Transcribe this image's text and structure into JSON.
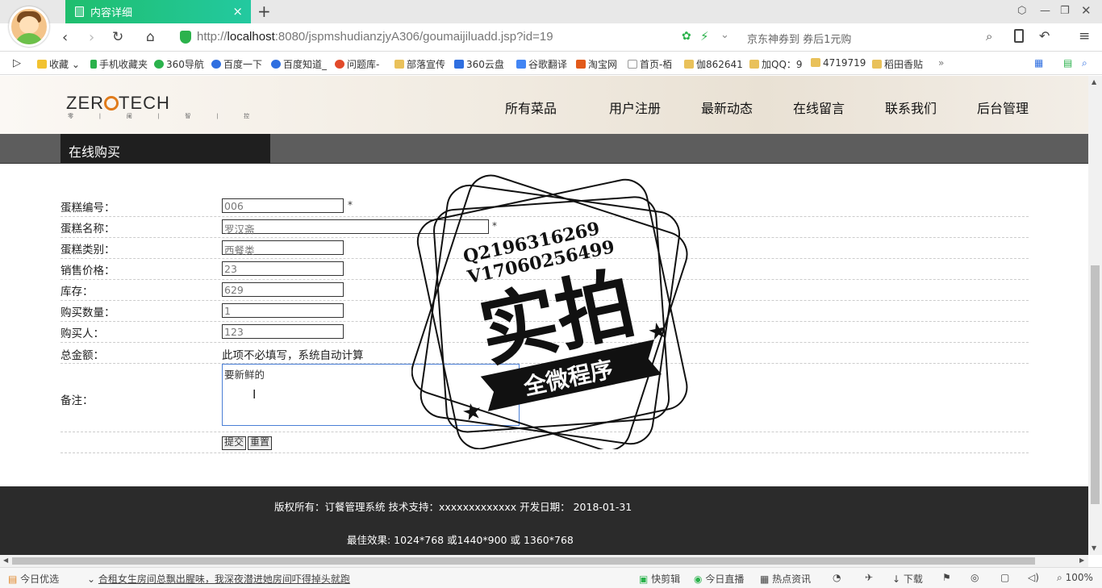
{
  "browser": {
    "tab_title": "内容详细",
    "url_prefix": "http://",
    "url_host": "localhost",
    "url_rest": ":8080/jspmshudianzjyA306/goumaijiluadd.jsp?id=19",
    "search_hint": "京东神券到 券后1元购",
    "bookmarks": [
      "收藏",
      "手机收藏夹",
      "360导航",
      "百度一下",
      "百度知道_",
      "问题库-",
      "部落宣传",
      "360云盘",
      "谷歌翻译",
      "淘宝网",
      "首页-栢",
      "伽862641",
      "加QQ：9",
      "4719719",
      "稻田香贴"
    ]
  },
  "site": {
    "logo": "ZER  TECH",
    "logo_sub": "零 | 阑 | 智 | 控",
    "nav": [
      "所有菜品",
      "用户注册",
      "最新动态",
      "在线留言",
      "联系我们",
      "后台管理"
    ],
    "section_title": "在线购买"
  },
  "form": {
    "fields": [
      {
        "label": "蛋糕编号：",
        "value": "006",
        "required": "*"
      },
      {
        "label": "蛋糕名称：",
        "value": "罗汉斋",
        "required": "*"
      },
      {
        "label": "蛋糕类别：",
        "value": "西餐类"
      },
      {
        "label": "销售价格：",
        "value": "23"
      },
      {
        "label": "库存：",
        "value": "629"
      },
      {
        "label": "购买数量：",
        "value": "1"
      },
      {
        "label": "购买人：",
        "value": "123"
      }
    ],
    "total_label": "总金额：",
    "total_hint": "此项不必填写，系统自动计算",
    "note_label": "备注：",
    "note_value": "要新鲜的",
    "submit": "提交",
    "reset": "重置"
  },
  "stamp": {
    "line1": "Q2196316269",
    "line2": "V17060256499",
    "big": "实拍",
    "ribbon": "全微程序"
  },
  "footer": {
    "line1": "版权所有：订餐管理系统 技术支持：xxxxxxxxxxxxx 开发日期： 2018-01-31",
    "line2": "最佳效果: 1024*768 或1440*900 或 1360*768"
  },
  "statusbar": {
    "left": "今日优选",
    "news": "合租女生房间总飘出腥味，我深夜潜进她房间吓得掉头就跑",
    "items": [
      "快剪辑",
      "今日直播",
      "热点资讯",
      "下载"
    ],
    "zoom": "100%"
  }
}
